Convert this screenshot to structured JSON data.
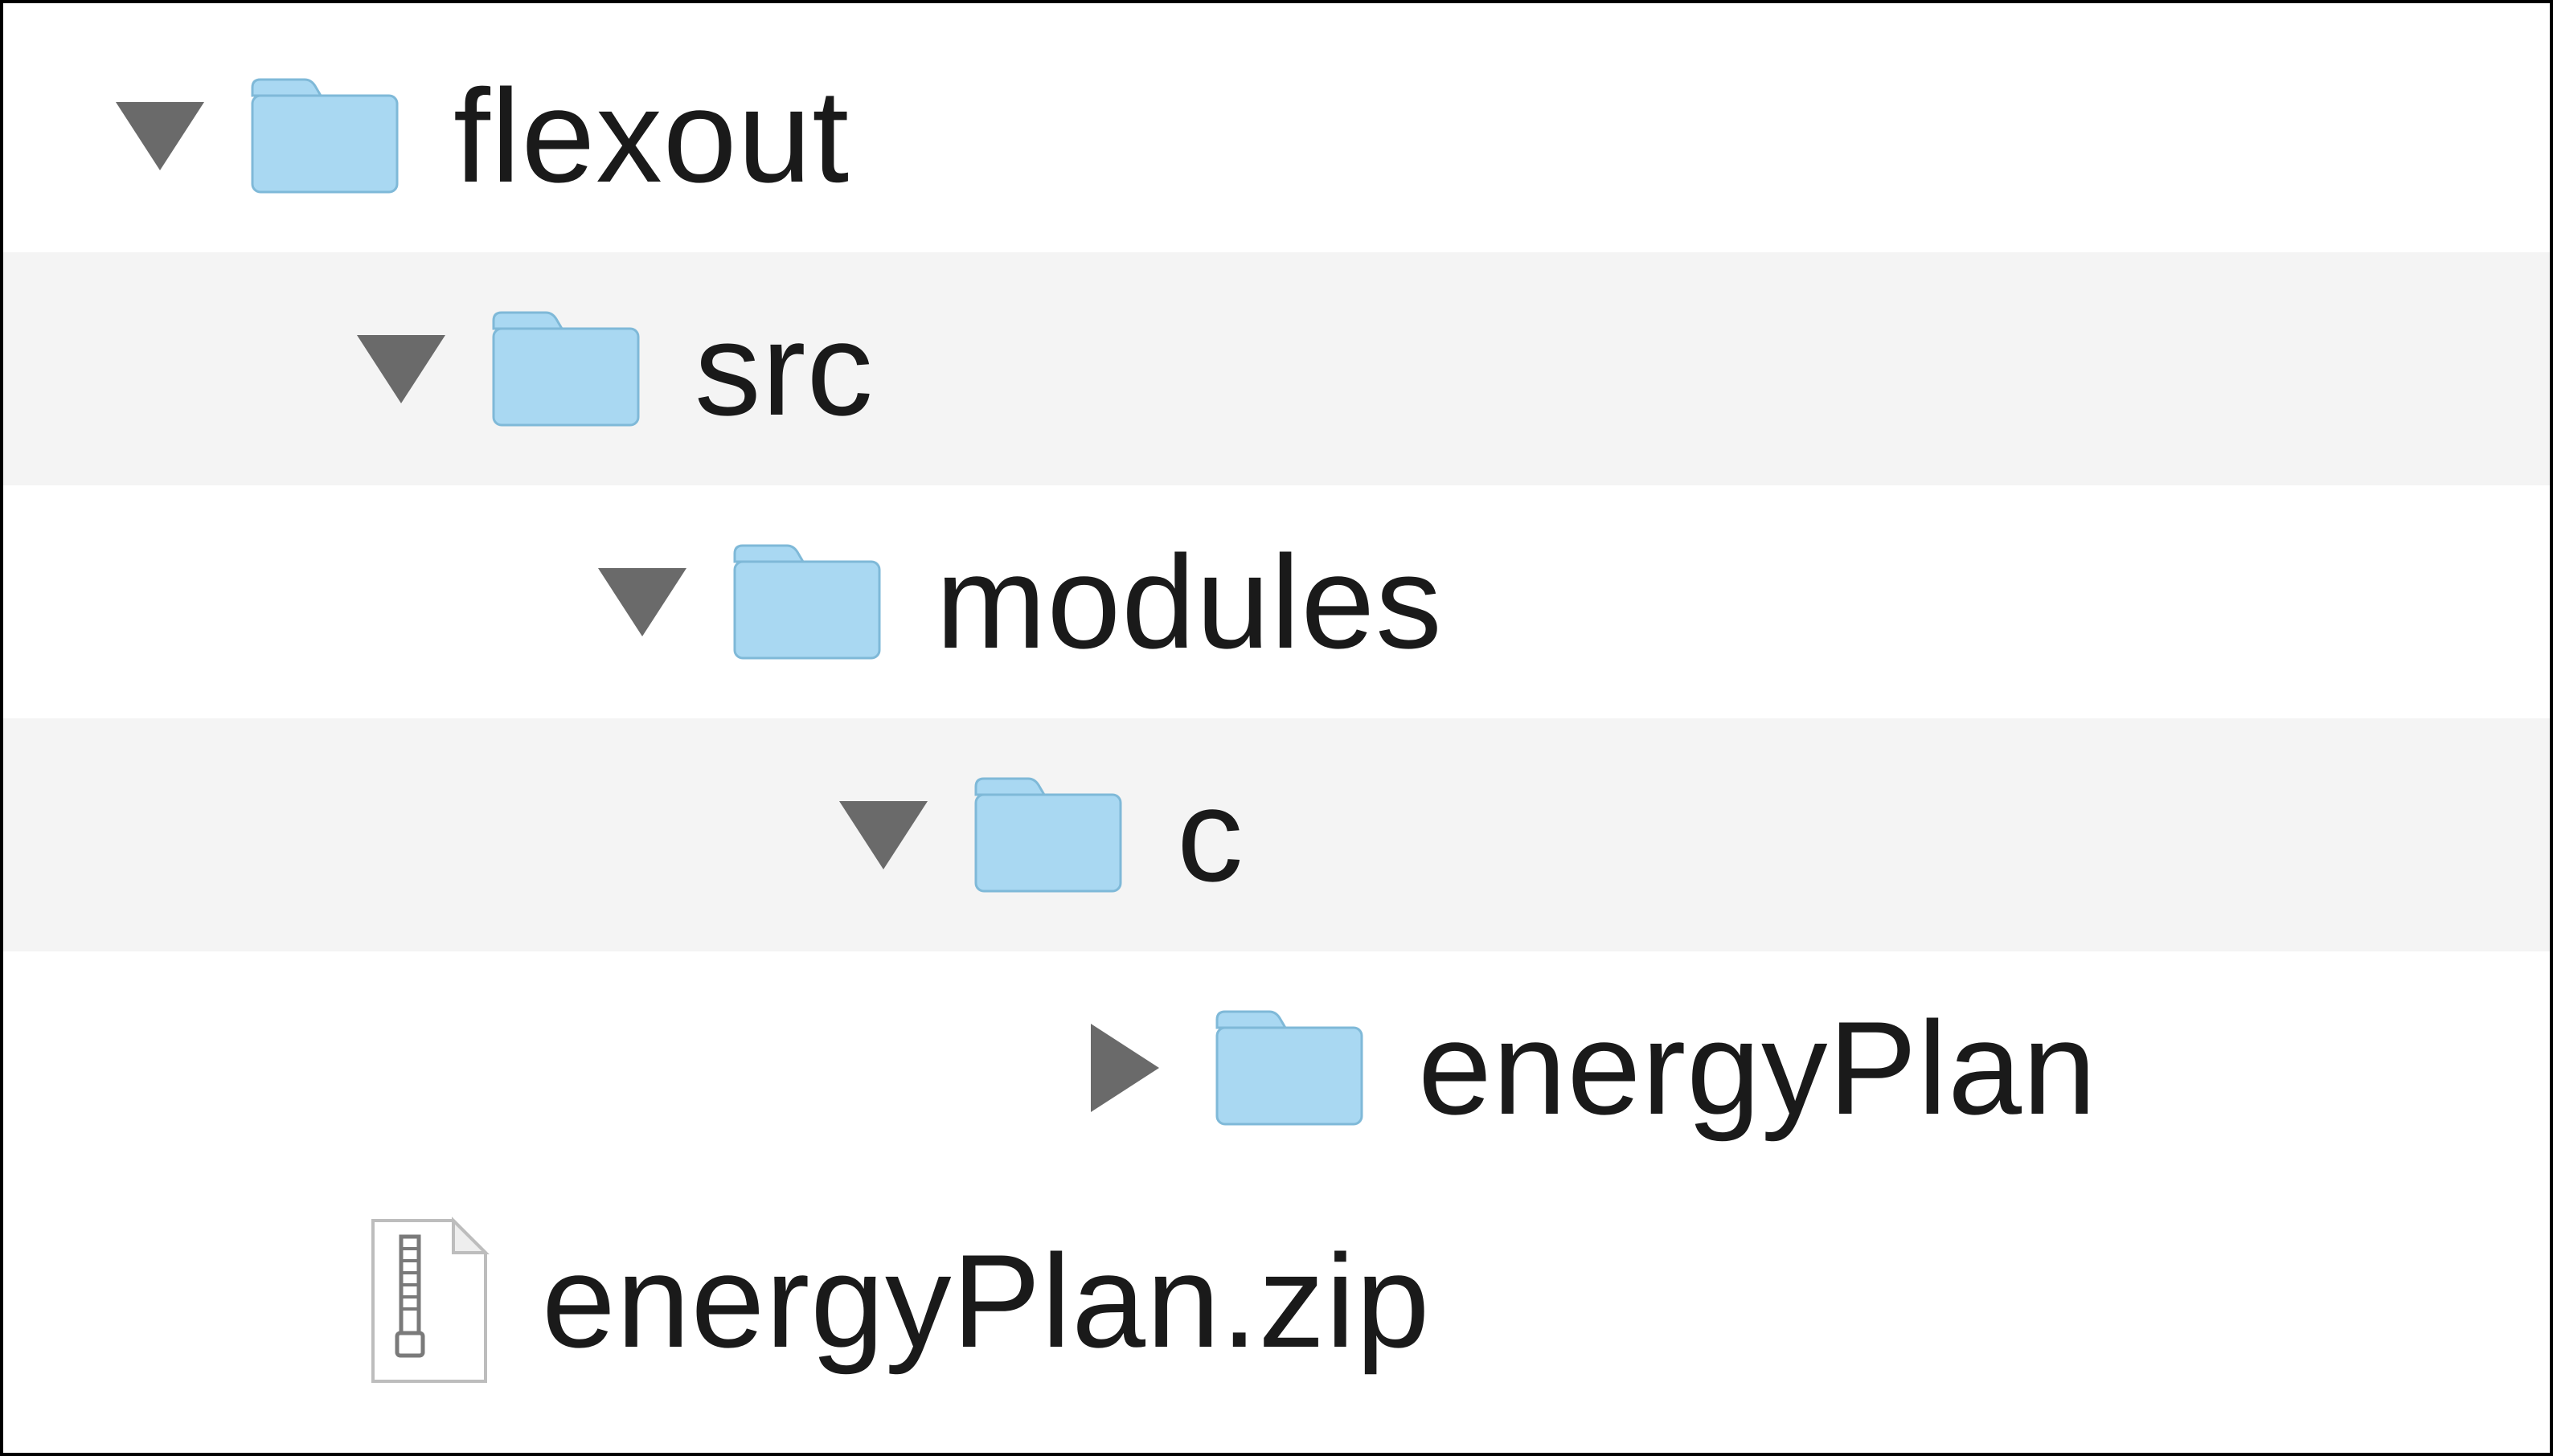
{
  "tree": {
    "items": [
      {
        "label": "flexout",
        "type": "folder",
        "expanded": true,
        "depth": 0,
        "alt": false
      },
      {
        "label": "src",
        "type": "folder",
        "expanded": true,
        "depth": 1,
        "alt": true
      },
      {
        "label": "modules",
        "type": "folder",
        "expanded": true,
        "depth": 2,
        "alt": false
      },
      {
        "label": "c",
        "type": "folder",
        "expanded": true,
        "depth": 3,
        "alt": true
      },
      {
        "label": "energyPlan",
        "type": "folder",
        "expanded": false,
        "depth": 4,
        "alt": false
      },
      {
        "label": "energyPlan.zip",
        "type": "zip",
        "expanded": null,
        "depth": 0,
        "alt": false,
        "noDisclosure": true
      }
    ]
  }
}
